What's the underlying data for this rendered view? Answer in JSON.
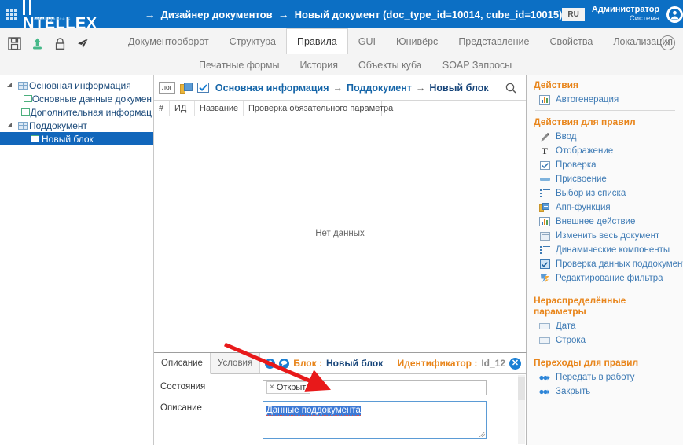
{
  "topbar": {
    "brand_i": "I",
    "brand_rest": "NTELLEX",
    "brand_tagline": "intelligence & experience",
    "breadcrumb": [
      "Дизайнер документов",
      "Новый документ (doc_type_id=10014, cube_id=10015)"
    ],
    "arrow": "→",
    "lang": "RU",
    "user_name": "Администратор",
    "user_role": "Система"
  },
  "menubar": {
    "icons": [
      "save-icon",
      "upload-icon",
      "lock-icon",
      "send-icon"
    ],
    "row1": [
      {
        "label": "Документооборот",
        "active": false
      },
      {
        "label": "Структура",
        "active": false
      },
      {
        "label": "Правила",
        "active": true
      },
      {
        "label": "GUI",
        "active": false
      },
      {
        "label": "Юнивёрс",
        "active": false
      },
      {
        "label": "Представление",
        "active": false
      },
      {
        "label": "Свойства",
        "active": false
      },
      {
        "label": "Локализация",
        "active": false
      }
    ],
    "row2": [
      {
        "label": "Печатные формы"
      },
      {
        "label": "История"
      },
      {
        "label": "Объекты куба"
      },
      {
        "label": "SOAP Запросы"
      }
    ],
    "close_label": "✕"
  },
  "tree": {
    "nodes": [
      {
        "label": "Основная информация",
        "indent": 0,
        "caret": "▲",
        "icon": "grid-icon",
        "selected": false
      },
      {
        "label": "Основные данные докумен",
        "indent": 1,
        "caret": "",
        "icon": "square-green-icon",
        "selected": false
      },
      {
        "label": "Дополнительная информац",
        "indent": 1,
        "caret": "",
        "icon": "square-green-icon",
        "selected": false
      },
      {
        "label": "Поддокумент",
        "indent": 0,
        "caret": "▲",
        "icon": "grid-icon",
        "selected": false
      },
      {
        "label": "Новый блок",
        "indent": 1,
        "caret": "",
        "icon": "square-green-icon",
        "selected": true
      }
    ]
  },
  "center": {
    "log_button": "лог",
    "breadcrumb": [
      "Основная информация",
      "Поддокумент",
      "Новый блок"
    ],
    "arrow": "→",
    "columns": [
      "#",
      "ИД",
      "Название",
      "Проверка обязательного параметра"
    ],
    "empty_message": "Нет данных"
  },
  "right": {
    "sections": [
      {
        "title": "Действия",
        "items": [
          {
            "label": "Автогенерация",
            "icon": "chart-icon"
          }
        ]
      },
      {
        "title": "Действия для правил",
        "items": [
          {
            "label": "Ввод",
            "icon": "pen-icon"
          },
          {
            "label": "Отображение",
            "icon": "text-T-icon"
          },
          {
            "label": "Проверка",
            "icon": "checkbox-icon"
          },
          {
            "label": "Присвоение",
            "icon": "dash-icon"
          },
          {
            "label": "Выбор из списка",
            "icon": "list-icon"
          },
          {
            "label": "Апп-функция",
            "icon": "app-function-icon"
          },
          {
            "label": "Внешнее действие",
            "icon": "chart-icon"
          },
          {
            "label": "Изменить весь документ",
            "icon": "document-icon"
          },
          {
            "label": "Динамические компоненты",
            "icon": "list-icon"
          },
          {
            "label": "Проверка данных поддокумента",
            "icon": "check-document-icon"
          },
          {
            "label": "Редактирование фильтра",
            "icon": "bolt-icon"
          }
        ]
      },
      {
        "title": "Нераспределённые параметры",
        "items": [
          {
            "label": "Дата",
            "icon": "field-icon"
          },
          {
            "label": "Строка",
            "icon": "field-icon"
          }
        ]
      },
      {
        "title": "Переходы для правил",
        "items": [
          {
            "label": "Передать в работу",
            "icon": "transition-icon"
          },
          {
            "label": "Закрыть",
            "icon": "transition-icon"
          }
        ]
      }
    ]
  },
  "bottom": {
    "tabs": [
      {
        "label": "Описание",
        "active": true
      },
      {
        "label": "Условия",
        "active": false
      }
    ],
    "help_icon": "?",
    "comment_icon": "comment-icon",
    "block_label": "Блок :",
    "block_value": "Новый блок",
    "identifier_label": "Идентификатор :",
    "identifier_value": "Id_12",
    "close_label": "✕",
    "fields": [
      {
        "label": "Состояния",
        "type": "tags",
        "tag_remove": "×",
        "value": "Открыт"
      },
      {
        "label": "Описание",
        "type": "textarea",
        "value": "Данные поддокумента"
      }
    ]
  },
  "colors": {
    "brand_blue": "#0c6fc4",
    "accent_orange": "#e8851b",
    "link_blue": "#3d7ab4",
    "selection_blue": "#1166bb",
    "annotation_red": "#e8191a"
  }
}
